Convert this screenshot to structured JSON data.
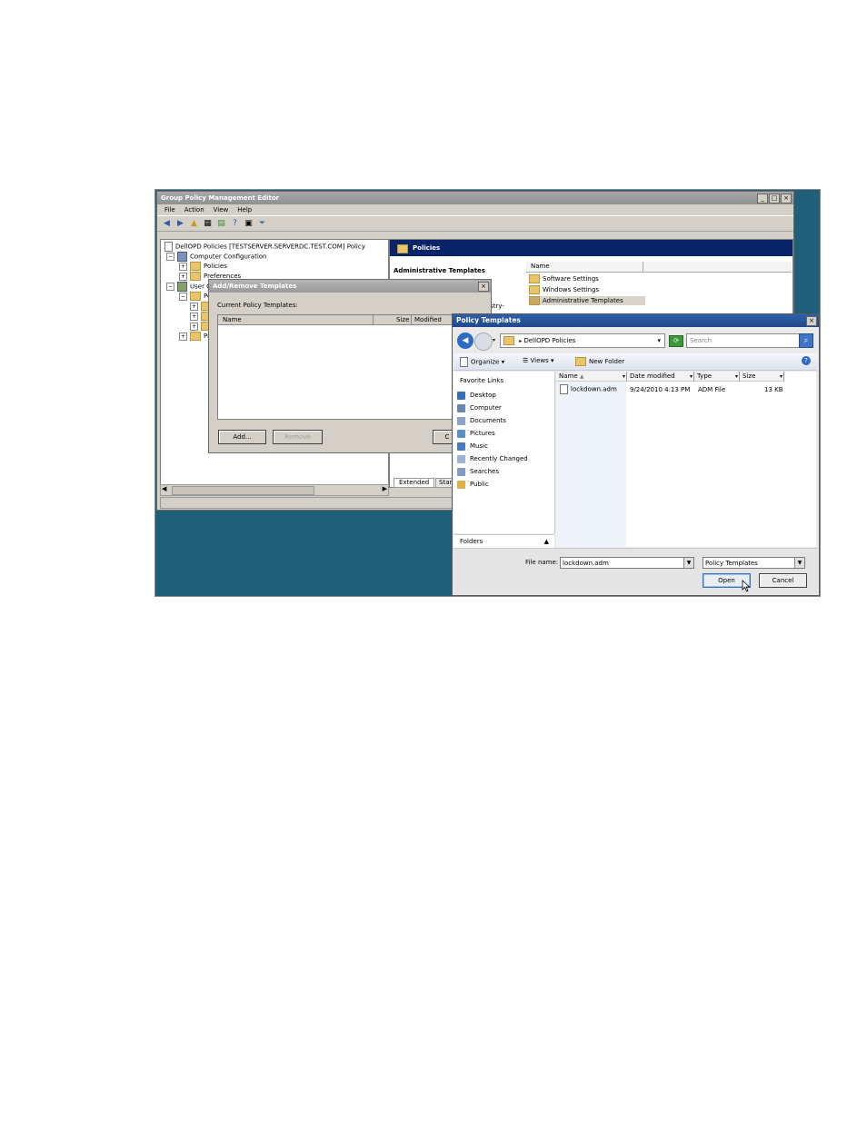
{
  "gpme": {
    "title": "Group Policy Management Editor",
    "menu": [
      "File",
      "Action",
      "View",
      "Help"
    ],
    "tree": {
      "root": "DellOPD Policies [TESTSERVER.SERVERDC.TEST.COM] Policy",
      "computer_config": "Computer Configuration",
      "policies": "Policies",
      "preferences": "Preferences",
      "user_config": "User C",
      "user_policies": "Poli",
      "user_pref": "Pre"
    },
    "right_header": "Policies",
    "admin_templates": "Administrative Templates",
    "partial_text": "istry-",
    "list_header": "Name",
    "list_items": [
      "Software Settings",
      "Windows Settings",
      "Administrative Templates"
    ],
    "tabs": [
      "Extended",
      "Stan"
    ]
  },
  "addremove": {
    "title": "Add/Remove Templates",
    "label": "Current Policy Templates:",
    "columns": [
      "Name",
      "Size",
      "Modified"
    ],
    "add_button": "Add...",
    "remove_button": "Remove",
    "close_button": "C"
  },
  "policy_templates": {
    "title": "Policy Templates",
    "address": "DellOPD Policies",
    "search_placeholder": "Search",
    "organize": "Organize",
    "views": "Views",
    "new_folder": "New Folder",
    "favorites_header": "Favorite Links",
    "favorites": [
      "Desktop",
      "Computer",
      "Documents",
      "Pictures",
      "Music",
      "Recently Changed",
      "Searches",
      "Public"
    ],
    "folders_label": "Folders",
    "columns": [
      "Name",
      "Date modified",
      "Type",
      "Size"
    ],
    "file": {
      "name": "lockdown.adm",
      "date": "9/24/2010 4:13 PM",
      "type": "ADM File",
      "size": "13 KB"
    },
    "file_name_label": "File name:",
    "file_name_value": "lockdown.adm",
    "filter_value": "Policy Templates",
    "open_button": "Open",
    "cancel_button": "Cancel"
  },
  "colors": {
    "desktop": "#1f5f7a",
    "title_active": "#1d4a8c",
    "header_blue": "#0a246a"
  }
}
